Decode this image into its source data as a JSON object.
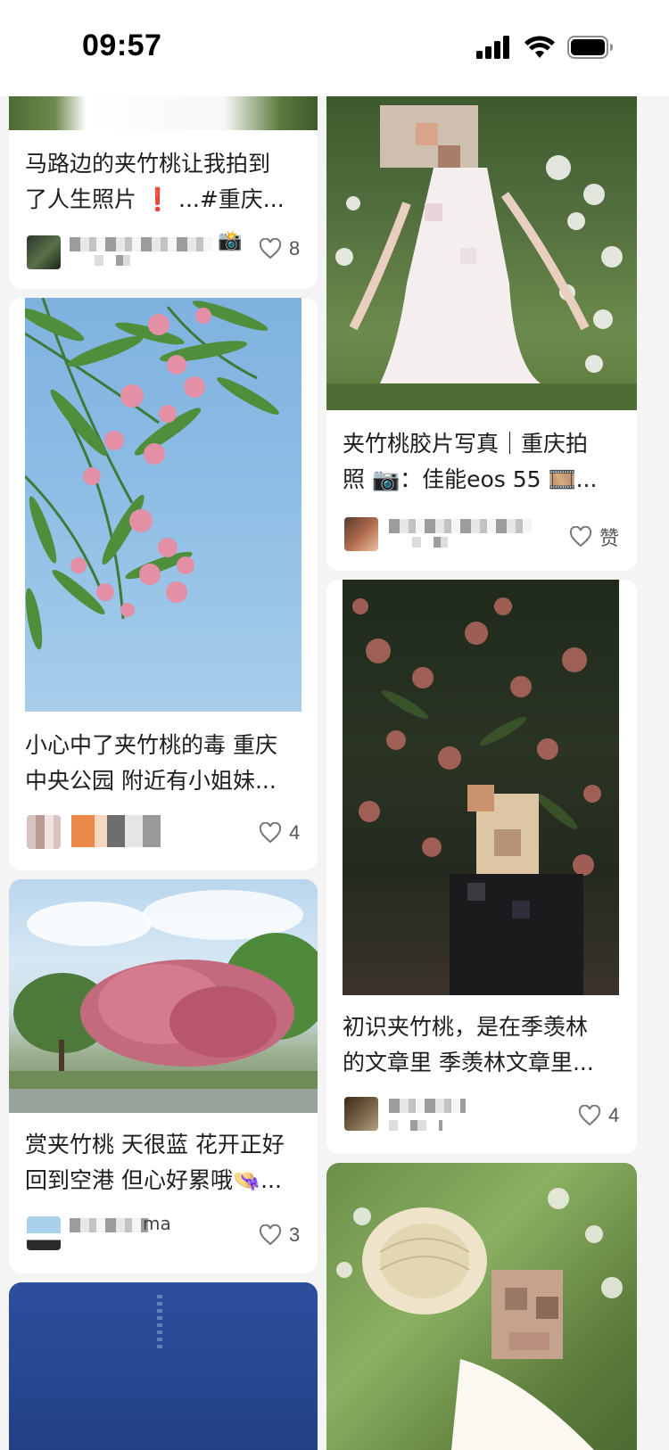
{
  "status": {
    "time": "09:57"
  },
  "cards": [
    {
      "title_line1": "马路边的夹竹桃让我拍到",
      "title_line2": "了人生照片 ❗ ...#重庆...",
      "likes": "8",
      "author_suffix": "📸"
    },
    {
      "title_line1": "夹竹桃胶片写真｜重庆拍",
      "title_line2": "照 📷：佳能eos 55 🎞️...",
      "likes": "赞"
    },
    {
      "title_line1": "小心中了夹竹桃的毒 重庆",
      "title_line2": "中央公园 附近有小姐妹...",
      "likes": "4"
    },
    {
      "title_line1": "初识夹竹桃，是在季羡林",
      "title_line2": "的文章里 季羡林文章里...",
      "likes": "4"
    },
    {
      "title_line1": "赏夹竹桃 天很蓝 花开正好",
      "title_line2": "回到空港 但心好累哦👒...",
      "likes": "3",
      "author_suffix": "ma"
    }
  ],
  "icons": {
    "like": "heart-outline-icon",
    "signal": "cellular-signal-icon",
    "wifi": "wifi-icon",
    "battery": "battery-icon"
  }
}
